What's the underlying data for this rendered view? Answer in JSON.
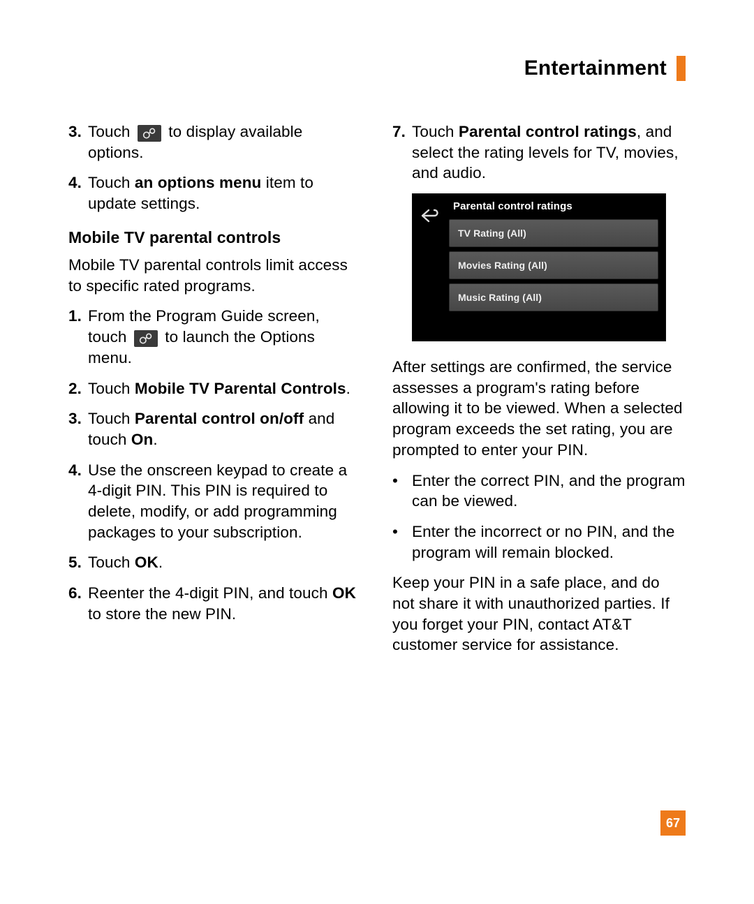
{
  "header": {
    "title": "Entertainment"
  },
  "page_number": "67",
  "left": {
    "step3": {
      "n": "3.",
      "a": "Touch ",
      "b": " to display available options."
    },
    "step4": {
      "n": "4.",
      "a": "Touch ",
      "bold": "an options menu",
      "b": " item to update settings."
    },
    "subhead": "Mobile TV parental controls",
    "intro": "Mobile TV parental controls limit access to specific rated programs.",
    "s1": {
      "n": "1.",
      "a": "From the Program Guide screen, touch ",
      "b": " to launch the Options menu."
    },
    "s2": {
      "n": "2.",
      "a": "Touch ",
      "bold": "Mobile TV Parental Controls",
      "b": "."
    },
    "s3": {
      "n": "3.",
      "a": "Touch ",
      "bold": "Parental control on/off",
      "b": " and touch ",
      "bold2": "On",
      "c": "."
    },
    "s4": {
      "n": "4.",
      "a": "Use the onscreen keypad to create a 4-digit PIN. This PIN is required to delete, modify, or add programming packages to your subscription."
    },
    "s5": {
      "n": "5.",
      "a": "Touch ",
      "bold": "OK",
      "b": "."
    },
    "s6": {
      "n": "6.",
      "a": "Reenter the 4-digit PIN, and touch ",
      "bold": "OK",
      "b": " to store the new PIN."
    }
  },
  "right": {
    "s7": {
      "n": "7.",
      "a": "Touch ",
      "bold": "Parental control ratings",
      "b": ", and select the rating levels for TV, movies, and audio."
    },
    "screenshot": {
      "title": "Parental control ratings",
      "rows": [
        "TV Rating (All)",
        "Movies Rating (All)",
        "Music Rating (All)"
      ]
    },
    "p1": "After settings are confirmed, the service assesses a program's rating before allowing it to be viewed. When a selected program exceeds the set rating, you are prompted to enter your PIN.",
    "b1": "Enter the correct PIN, and the program can be viewed.",
    "b2": "Enter the incorrect or no PIN, and the program will remain blocked.",
    "p2": "Keep your PIN in a safe place, and do not share it with unauthorized parties. If you forget your PIN, contact AT&T customer service for assistance."
  }
}
